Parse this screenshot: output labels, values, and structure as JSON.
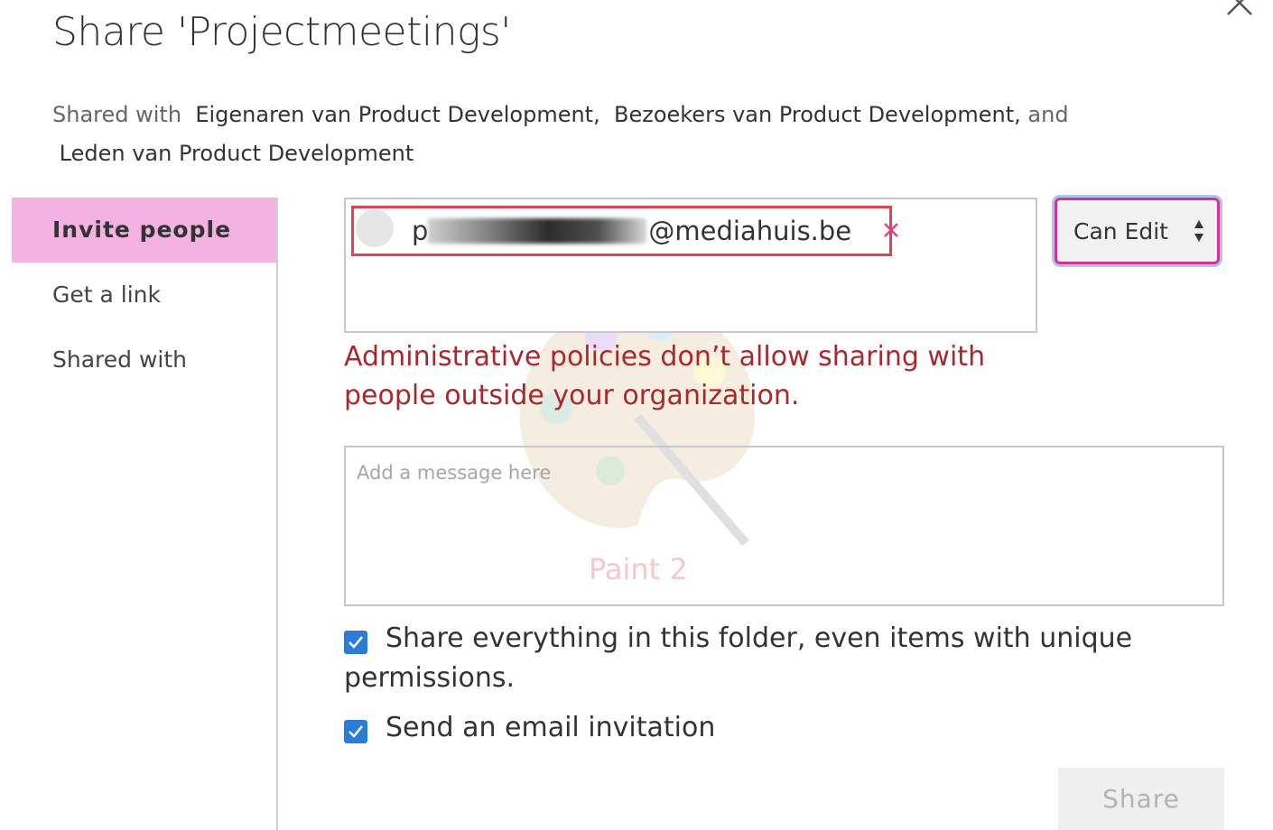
{
  "dialog": {
    "title": "Share 'Projectmeetings'",
    "close_icon": "close-icon"
  },
  "shared_with": {
    "prefix": "Shared with",
    "groups": [
      "Eigenaren van Product Development,",
      "Bezoekers van Product Development,",
      "Leden van Product Development"
    ],
    "conjunction": "and"
  },
  "nav": {
    "items": [
      {
        "label": "Invite people",
        "active": true
      },
      {
        "label": "Get a link",
        "active": false
      },
      {
        "label": "Shared with",
        "active": false
      }
    ]
  },
  "picker": {
    "chip": {
      "visible_prefix": "p",
      "visible_suffix": "@mediahuis.be",
      "remove_icon": "close-icon"
    }
  },
  "permission": {
    "selected": "Can Edit"
  },
  "error": {
    "message": "Administrative policies don’t allow sharing with people outside your organization."
  },
  "message_box": {
    "placeholder": "Add a message here",
    "value": ""
  },
  "watermark": {
    "label": "Paint 2"
  },
  "options": {
    "share_everything": {
      "label": "Share everything in this folder, even items with unique permissions.",
      "checked": true
    },
    "send_email": {
      "label": "Send an email invitation",
      "checked": true
    }
  },
  "actions": {
    "share_label": "Share",
    "share_enabled": false
  },
  "colors": {
    "nav_active_bg": "#f5b1e1",
    "error_text": "#a9282e",
    "chip_border": "#e2424d",
    "checkbox_fill": "#2b7cd6",
    "select_border": "#d6338e"
  }
}
